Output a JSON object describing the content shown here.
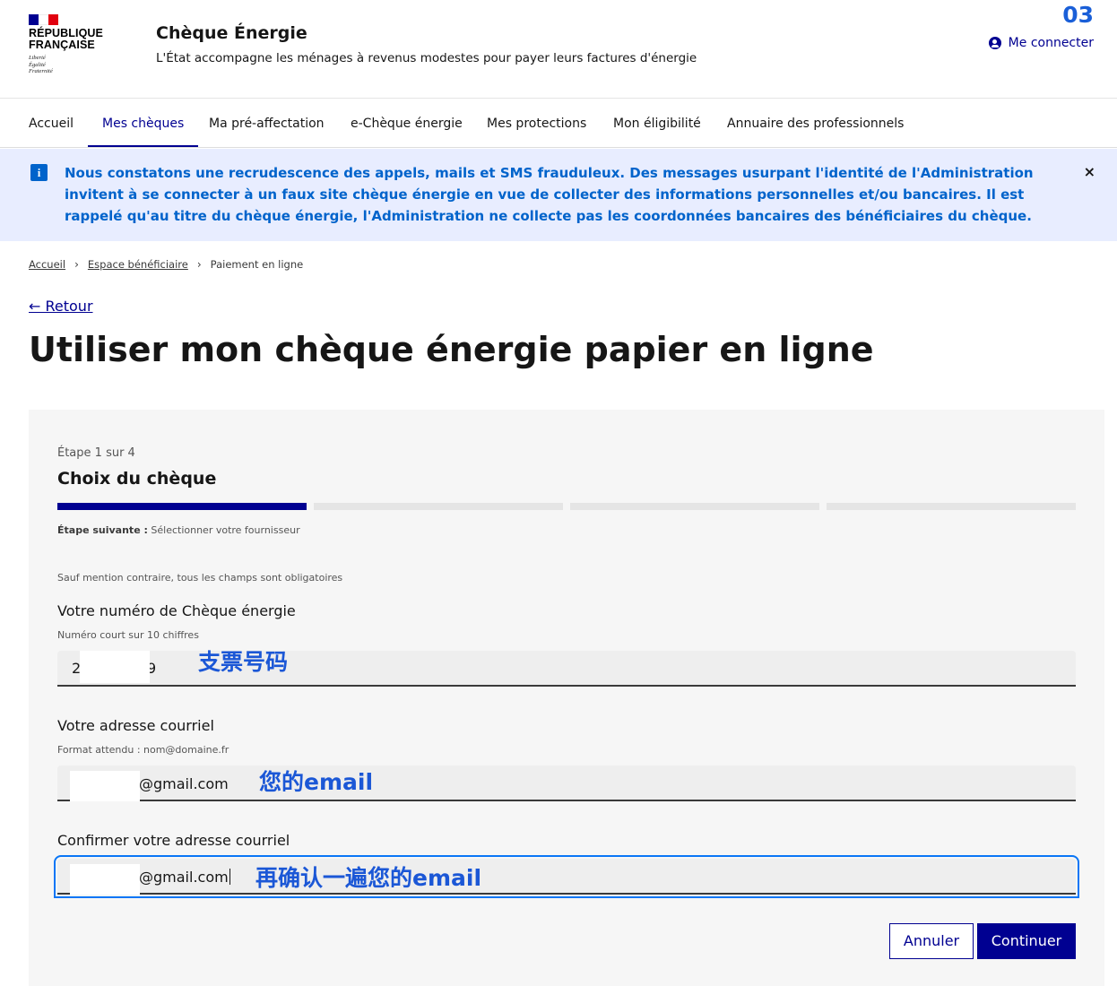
{
  "header": {
    "logo_lines": [
      "RÉPUBLIQUE",
      "FRANÇAISE"
    ],
    "logo_motto": [
      "Liberté",
      "Égalité",
      "Fraternité"
    ],
    "site_title": "Chèque Énergie",
    "tagline": "L'État accompagne les ménages à revenus modestes pour payer leurs factures d'énergie",
    "corner_number": "03",
    "login_label": "Me connecter"
  },
  "nav": {
    "items": [
      "Accueil",
      "Mes chèques",
      "Ma pré-affectation",
      "e-Chèque énergie",
      "Mes protections",
      "Mon éligibilité",
      "Annuaire des professionnels"
    ],
    "active_index": 1
  },
  "alert": {
    "text": "Nous constatons une recrudescence des appels, mails et SMS frauduleux. Des messages usurpant l'identité de l'Administration invitent à se connecter à un faux site chèque énergie en vue de collecter des informations personnelles et/ou bancaires. Il est rappelé qu'au titre du chèque énergie, l'Administration ne collecte pas les coordonnées bancaires des bénéficiaires du chèque.",
    "close_glyph": "×",
    "icon_glyph": "i"
  },
  "breadcrumb": {
    "items": [
      "Accueil",
      "Espace bénéficiaire",
      "Paiement en ligne"
    ]
  },
  "back_label": "← Retour",
  "page_title": "Utiliser mon chèque énergie papier en ligne",
  "form": {
    "step_label": "Étape 1 sur 4",
    "step_title": "Choix du chèque",
    "current_step": 1,
    "total_steps": 4,
    "next_step_prefix": "Étape suivante :",
    "next_step_text": " Sélectionner votre fournisseur",
    "mention": "Sauf mention contraire, tous les champs sont obligatoires",
    "fields": [
      {
        "label": "Votre numéro de Chèque énergie",
        "hint": "Numéro court sur 10 chiffres",
        "value_start": "2",
        "value_end": "9",
        "annotation": "支票号码"
      },
      {
        "label": "Votre adresse courriel",
        "hint": "Format attendu : nom@domaine.fr",
        "value": "@gmail.com",
        "annotation": "您的email"
      },
      {
        "label": "Confirmer votre adresse courriel",
        "value": "@gmail.com",
        "annotation": "再确认一遍您的email"
      }
    ],
    "cancel_label": "Annuler",
    "continue_label": "Continuer"
  },
  "colors": {
    "primary_blue": "#000091",
    "info_blue": "#0063cb",
    "alert_bg": "#e8edff",
    "annotation_blue": "#1b57d6",
    "flag_red": "#e1000f"
  }
}
